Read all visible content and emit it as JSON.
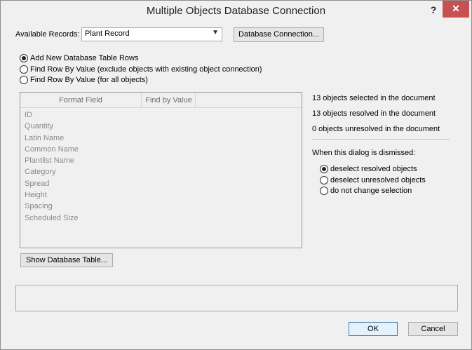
{
  "window": {
    "title": "Multiple Objects Database Connection",
    "help_label": "?",
    "close_label": "✕"
  },
  "records": {
    "label": "Available Records:",
    "selected": "Plant Record",
    "db_connection_button": "Database Connection..."
  },
  "mode_options": [
    {
      "label": "Add New Database Table Rows",
      "checked": true
    },
    {
      "label": "Find Row By Value (exclude objects with existing object connection)",
      "checked": false
    },
    {
      "label": "Find Row By Value (for all objects)",
      "checked": false
    }
  ],
  "table": {
    "columns": [
      "Format Field",
      "Find by Value"
    ],
    "fields": [
      "ID",
      "Quantity",
      "Latin Name",
      "Common Name",
      "Plantlist Name",
      "Category",
      "Spread",
      "Height",
      "Spacing",
      "Scheduled Size"
    ]
  },
  "stats": {
    "selected": "13 objects selected in the document",
    "resolved": "13 objects resolved in the document",
    "unresolved": "0 objects unresolved in the document"
  },
  "dismiss": {
    "label": "When this dialog is dismissed:",
    "options": [
      {
        "label": "deselect resolved objects",
        "checked": true
      },
      {
        "label": "deselect unresolved objects",
        "checked": false
      },
      {
        "label": "do not change selection",
        "checked": false
      }
    ]
  },
  "buttons": {
    "show_table": "Show Database Table...",
    "ok": "OK",
    "cancel": "Cancel"
  }
}
